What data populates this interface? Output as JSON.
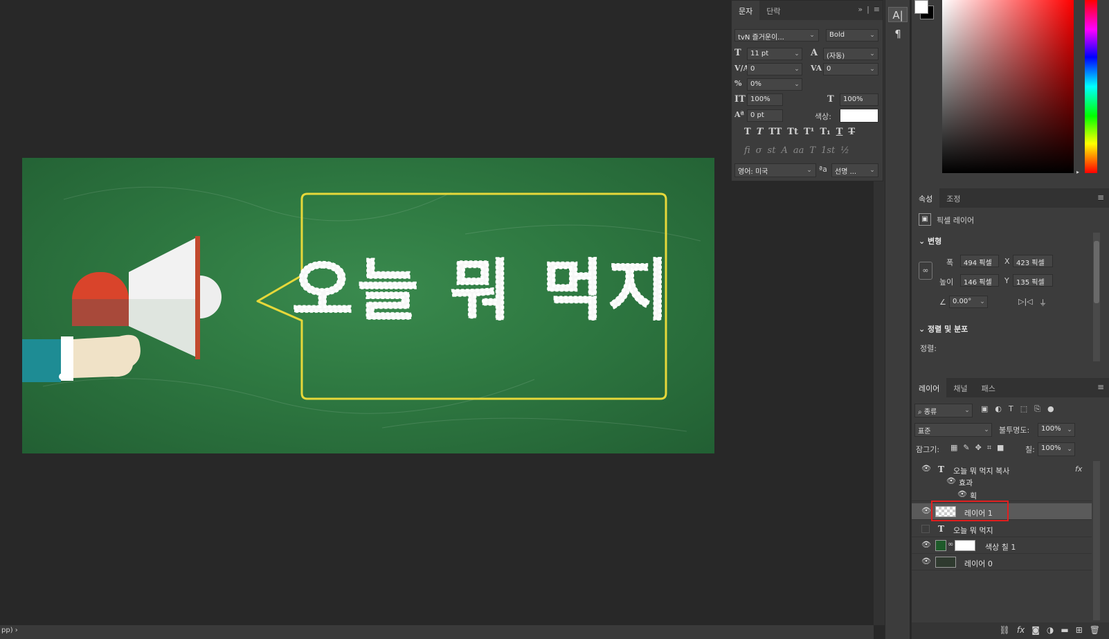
{
  "status_bar": {
    "text": "pp) ›"
  },
  "canvas": {
    "headline": "오늘 뭐 먹지",
    "colors": {
      "board": "#2f7a42",
      "frame": "#e6d83a",
      "text_outline": "#ffffff",
      "megaphone_red": "#d9442b",
      "sleeve": "#1e8c94"
    }
  },
  "character_panel": {
    "tabs": [
      "문자",
      "단락"
    ],
    "collapse_icon": "double-chevron-icon",
    "font_family": "tvN 즐거운이...",
    "font_style": "Bold",
    "font_size": "11 pt",
    "leading": "(자동)",
    "kerning": "0",
    "tracking": "0",
    "tsume": "0%",
    "vertical_scale": "100%",
    "horizontal_scale": "100%",
    "baseline_shift": "0 pt",
    "color_label": "색상:",
    "color_value": "#ffffff",
    "type_styles": [
      "T",
      "T",
      "TT",
      "Tt",
      "T¹",
      "T₁",
      "T",
      "T"
    ],
    "opentype": [
      "fi",
      "σ",
      "st",
      "A",
      "aa",
      "T",
      "1st",
      "½"
    ],
    "language": "영어: 미국",
    "aa_label": "ªa",
    "antialias": "선명 ..."
  },
  "tool_strip": {
    "tools": [
      "character-panel-icon",
      "paragraph-icon"
    ]
  },
  "properties_panel": {
    "tabs": [
      "속성",
      "조정"
    ],
    "layer_type": "픽셀 레이어",
    "transform_heading": "변형",
    "width_label": "폭",
    "width_value": "494 픽셀",
    "x_label": "X",
    "x_value": "423 픽셀",
    "height_label": "높이",
    "height_value": "146 픽셀",
    "y_label": "Y",
    "y_value": "135 픽셀",
    "angle_value": "0.00°",
    "align_heading": "정렬 및 분포",
    "align_label": "정렬:"
  },
  "layers_panel": {
    "tabs": [
      "레이어",
      "채널",
      "패스"
    ],
    "filter_kind": "종류",
    "blend_mode": "표준",
    "opacity_label": "불투명도:",
    "opacity_value": "100%",
    "lock_label": "잠그기:",
    "fill_label": "칠:",
    "fill_value": "100%",
    "fx_label": "fx",
    "layers": [
      {
        "name": "오늘 뭐 먹지 복사",
        "type": "text",
        "visible": true
      },
      {
        "name": "효과",
        "type": "effects"
      },
      {
        "name": "획",
        "type": "effect"
      },
      {
        "name": "레이어 1",
        "type": "pixel",
        "visible": true,
        "selected": true
      },
      {
        "name": "오늘 뭐 먹지",
        "type": "text",
        "visible": false
      },
      {
        "name": "색상 칠 1",
        "type": "fill",
        "visible": true
      },
      {
        "name": "레이어 0",
        "type": "pixel",
        "visible": true
      }
    ],
    "bottom_icons": [
      "link-icon",
      "fx-icon",
      "mask-icon",
      "adjustment-icon",
      "folder-icon",
      "new-layer-icon",
      "trash-icon"
    ]
  }
}
